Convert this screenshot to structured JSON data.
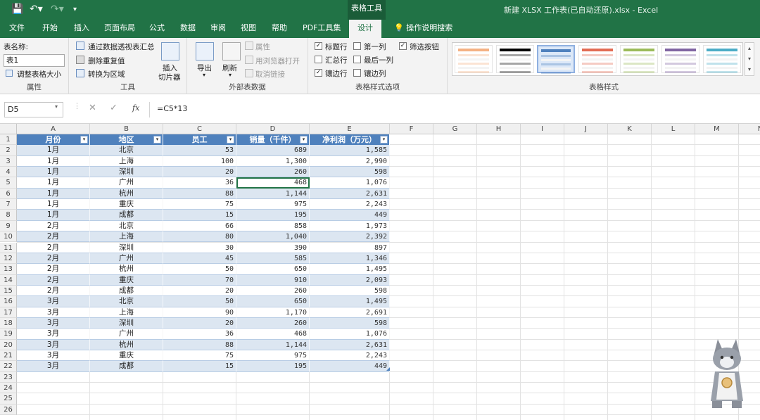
{
  "titlebar": {
    "context_tab_group": "表格工具",
    "document_title": "新建 XLSX 工作表(已自动还原).xlsx  -  Excel"
  },
  "tabs": [
    "文件",
    "开始",
    "插入",
    "页面布局",
    "公式",
    "数据",
    "审阅",
    "视图",
    "帮助",
    "PDF工具集",
    "设计"
  ],
  "tell_me": "操作说明搜索",
  "ribbon": {
    "properties": {
      "table_name_label": "表名称:",
      "table_name_value": "表1",
      "resize_label": "调整表格大小",
      "group_label": "属性"
    },
    "tools": {
      "pivot_label": "通过数据透视表汇总",
      "remove_dup_label": "删除重复值",
      "convert_label": "转换为区域",
      "slicer_label_1": "插入",
      "slicer_label_2": "切片器",
      "group_label": "工具"
    },
    "external": {
      "export_label": "导出",
      "refresh_label": "刷新",
      "props_label": "属性",
      "open_browser_label": "用浏览器打开",
      "unlink_label": "取消链接",
      "group_label": "外部表数据"
    },
    "style_options": {
      "header_row": "标题行",
      "total_row": "汇总行",
      "banded_rows": "镶边行",
      "first_col": "第一列",
      "last_col": "最后一列",
      "banded_cols": "镶边列",
      "filter_button": "筛选按钮",
      "group_label": "表格样式选项"
    },
    "styles": {
      "group_label": "表格样式",
      "swatch_colors": [
        "#f4b183",
        "#000000",
        "#4f81bd",
        "#e26b53",
        "#9bbb59",
        "#8064a2",
        "#4bacc6"
      ]
    }
  },
  "formula_bar": {
    "name_box": "D5",
    "cancel": "✕",
    "enter": "✓",
    "fx": "fx",
    "formula": "=C5*13"
  },
  "grid": {
    "column_letters": [
      "A",
      "B",
      "C",
      "D",
      "E",
      "F",
      "G",
      "H",
      "I",
      "J",
      "K",
      "L",
      "M",
      "N"
    ],
    "row_numbers": [
      "1",
      "2",
      "3",
      "4",
      "5",
      "6",
      "7",
      "8",
      "9",
      "10",
      "11",
      "12",
      "13",
      "14",
      "15",
      "16",
      "17",
      "18",
      "19",
      "20",
      "21",
      "22",
      "23",
      "24",
      "25",
      "26"
    ],
    "headers": [
      "月份",
      "地区",
      "员工",
      "销量（千件）",
      "净利润（万元）"
    ],
    "rows": [
      [
        "1月",
        "北京",
        "53",
        "689",
        "1,585"
      ],
      [
        "1月",
        "上海",
        "100",
        "1,300",
        "2,990"
      ],
      [
        "1月",
        "深圳",
        "20",
        "260",
        "598"
      ],
      [
        "1月",
        "广州",
        "36",
        "468",
        "1,076"
      ],
      [
        "1月",
        "杭州",
        "88",
        "1,144",
        "2,631"
      ],
      [
        "1月",
        "重庆",
        "75",
        "975",
        "2,243"
      ],
      [
        "1月",
        "成都",
        "15",
        "195",
        "449"
      ],
      [
        "2月",
        "北京",
        "66",
        "858",
        "1,973"
      ],
      [
        "2月",
        "上海",
        "80",
        "1,040",
        "2,392"
      ],
      [
        "2月",
        "深圳",
        "30",
        "390",
        "897"
      ],
      [
        "2月",
        "广州",
        "45",
        "585",
        "1,346"
      ],
      [
        "2月",
        "杭州",
        "50",
        "650",
        "1,495"
      ],
      [
        "2月",
        "重庆",
        "70",
        "910",
        "2,093"
      ],
      [
        "2月",
        "成都",
        "20",
        "260",
        "598"
      ],
      [
        "3月",
        "北京",
        "50",
        "650",
        "1,495"
      ],
      [
        "3月",
        "上海",
        "90",
        "1,170",
        "2,691"
      ],
      [
        "3月",
        "深圳",
        "20",
        "260",
        "598"
      ],
      [
        "3月",
        "广州",
        "36",
        "468",
        "1,076"
      ],
      [
        "3月",
        "杭州",
        "88",
        "1,144",
        "2,631"
      ],
      [
        "3月",
        "重庆",
        "75",
        "975",
        "2,243"
      ],
      [
        "3月",
        "成都",
        "15",
        "195",
        "449"
      ]
    ]
  }
}
